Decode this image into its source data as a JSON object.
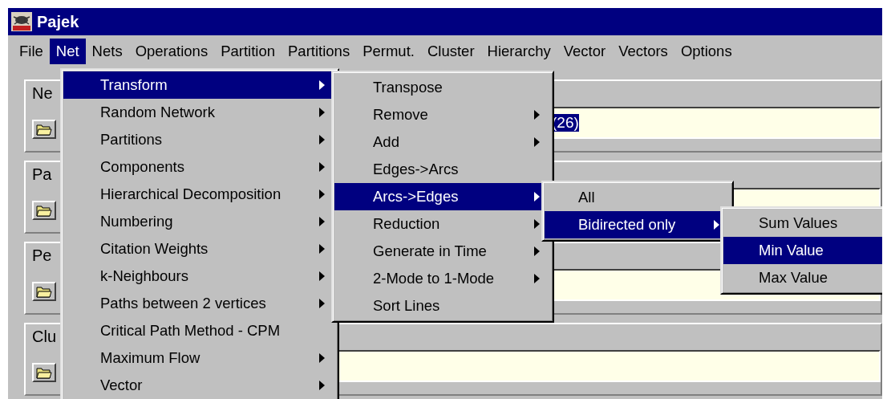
{
  "window": {
    "title": "Pajek"
  },
  "menubar": [
    {
      "label": "File",
      "selected": false
    },
    {
      "label": "Net",
      "selected": true
    },
    {
      "label": "Nets",
      "selected": false
    },
    {
      "label": "Operations",
      "selected": false
    },
    {
      "label": "Partition",
      "selected": false
    },
    {
      "label": "Partitions",
      "selected": false
    },
    {
      "label": "Permut.",
      "selected": false
    },
    {
      "label": "Cluster",
      "selected": false
    },
    {
      "label": "Hierarchy",
      "selected": false
    },
    {
      "label": "Vector",
      "selected": false
    },
    {
      "label": "Vectors",
      "selected": false
    },
    {
      "label": "Options",
      "selected": false
    }
  ],
  "panels": [
    {
      "label": "Ne",
      "value": "(26)",
      "value_selected": true
    },
    {
      "label": "Pa"
    },
    {
      "label": "Pe"
    },
    {
      "label": "Clu"
    }
  ],
  "menus": [
    {
      "items": [
        {
          "label": "Transform",
          "submenu": true,
          "selected": true
        },
        {
          "label": "Random Network",
          "submenu": true,
          "selected": false
        },
        {
          "label": "Partitions",
          "submenu": true,
          "selected": false
        },
        {
          "label": "Components",
          "submenu": true,
          "selected": false
        },
        {
          "label": "Hierarchical Decomposition",
          "submenu": true,
          "selected": false
        },
        {
          "label": "Numbering",
          "submenu": true,
          "selected": false
        },
        {
          "label": "Citation Weights",
          "submenu": true,
          "selected": false
        },
        {
          "label": "k-Neighbours",
          "submenu": true,
          "selected": false
        },
        {
          "label": "Paths between 2 vertices",
          "submenu": true,
          "selected": false
        },
        {
          "label": "Critical Path Method - CPM",
          "submenu": false,
          "selected": false
        },
        {
          "label": "Maximum Flow",
          "submenu": true,
          "selected": false
        },
        {
          "label": "Vector",
          "submenu": true,
          "selected": false
        }
      ]
    },
    {
      "items": [
        {
          "label": "Transpose",
          "submenu": false,
          "selected": false
        },
        {
          "label": "Remove",
          "submenu": true,
          "selected": false
        },
        {
          "label": "Add",
          "submenu": true,
          "selected": false
        },
        {
          "label": "Edges->Arcs",
          "submenu": false,
          "selected": false
        },
        {
          "label": "Arcs->Edges",
          "submenu": true,
          "selected": true
        },
        {
          "label": "Reduction",
          "submenu": true,
          "selected": false
        },
        {
          "label": "Generate in Time",
          "submenu": true,
          "selected": false
        },
        {
          "label": "2-Mode to 1-Mode",
          "submenu": true,
          "selected": false
        },
        {
          "label": "Sort Lines",
          "submenu": false,
          "selected": false
        }
      ]
    },
    {
      "items": [
        {
          "label": "All",
          "submenu": false,
          "selected": false
        },
        {
          "label": "Bidirected only",
          "submenu": true,
          "selected": true
        }
      ]
    },
    {
      "items": [
        {
          "label": "Sum Values",
          "submenu": false,
          "selected": false
        },
        {
          "label": "Min Value",
          "submenu": false,
          "selected": true
        },
        {
          "label": "Max Value",
          "submenu": false,
          "selected": false
        }
      ]
    }
  ]
}
